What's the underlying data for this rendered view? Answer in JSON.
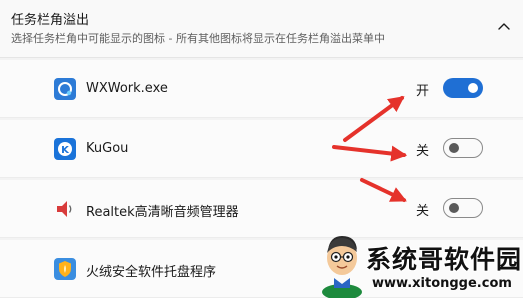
{
  "section": {
    "title": "任务栏角溢出",
    "subtitle": "选择任务栏角中可能显示的图标 - 所有其他图标将显示在任务栏角溢出菜单中"
  },
  "apps": [
    {
      "name": "WXWork.exe",
      "state": "开",
      "on": true,
      "icon": "wxwork-icon"
    },
    {
      "name": "KuGou",
      "state": "关",
      "on": false,
      "icon": "kugou-icon"
    },
    {
      "name": "Realtek高清晰音频管理器",
      "state": "关",
      "on": false,
      "icon": "speaker-icon"
    },
    {
      "name": "火绒安全软件托盘程序",
      "state": "",
      "on": null,
      "icon": "shield-icon"
    }
  ],
  "watermark": {
    "text": "系统哥软件园",
    "url": "www.xitongge.com"
  },
  "colors": {
    "accent": "#1f6fd4",
    "arrow": "#e5322b"
  }
}
